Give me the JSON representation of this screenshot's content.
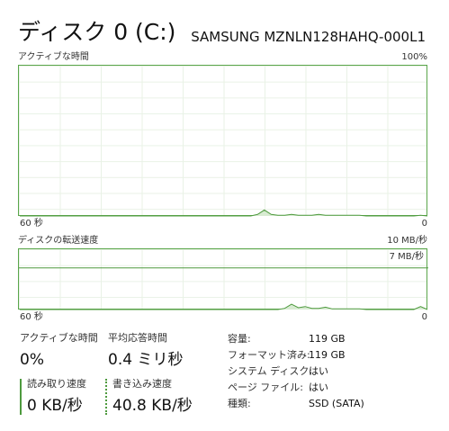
{
  "header": {
    "title": "ディスク 0 (C:)",
    "model": "SAMSUNG MZNLN128HAHQ-000L1"
  },
  "chart1": {
    "label": "アクティブな時間",
    "max_label": "100%",
    "time_left": "60 秒",
    "time_right": "0"
  },
  "chart2": {
    "label": "ディスクの転送速度",
    "max_label": "10 MB/秒",
    "line_label": "7 MB/秒",
    "time_left": "60 秒",
    "time_right": "0"
  },
  "stats": {
    "active_time_label": "アクティブな時間",
    "active_time_value": "0%",
    "avg_response_label": "平均応答時間",
    "avg_response_value": "0.4 ミリ秒",
    "read_speed_label": "読み取り速度",
    "read_speed_value": "0 KB/秒",
    "write_speed_label": "書き込み速度",
    "write_speed_value": "40.8 KB/秒"
  },
  "properties": [
    {
      "key": "容量:",
      "value": "119 GB"
    },
    {
      "key": "フォーマット済み:",
      "value": "119 GB"
    },
    {
      "key": "システム ディスク:",
      "value": "はい"
    },
    {
      "key": "ページ ファイル:",
      "value": "はい"
    },
    {
      "key": "種類:",
      "value": "SSD (SATA)"
    }
  ],
  "colors": {
    "accent": "#4e9a3e",
    "fill": "#d8ebd2",
    "grid": "#e9f2e6"
  },
  "chart_data": [
    {
      "type": "area",
      "name": "active-time",
      "ylim": [
        0,
        100
      ],
      "xlim": [
        60,
        0
      ],
      "x": [
        60,
        26,
        25,
        24,
        23,
        22,
        21,
        20,
        19,
        18,
        17,
        16,
        15,
        14,
        13,
        12,
        11,
        10,
        9,
        8,
        7,
        6,
        5,
        4,
        3,
        2,
        1,
        0
      ],
      "y": [
        0,
        0,
        1,
        4,
        1,
        0.5,
        0.5,
        1,
        0.5,
        0.5,
        0.5,
        1,
        0.5,
        0.5,
        0.5,
        0.5,
        0.5,
        0.5,
        0,
        0,
        0,
        0,
        0,
        0,
        0,
        0,
        0.5,
        0
      ]
    },
    {
      "type": "area",
      "name": "transfer-rate",
      "ylim": [
        0,
        10
      ],
      "xlim": [
        60,
        0
      ],
      "reference_line": 7,
      "series": [
        {
          "x": [
            60,
            22,
            21,
            20,
            19,
            18,
            17,
            16,
            15,
            14,
            13,
            12,
            11,
            10,
            9,
            8,
            7,
            6,
            5,
            4,
            3,
            2,
            1,
            0
          ],
          "y": [
            0,
            0,
            0.2,
            0.9,
            0.3,
            0.5,
            0.2,
            0.2,
            0.4,
            0.1,
            0.1,
            0.1,
            0.1,
            0.1,
            0,
            0,
            0,
            0,
            0,
            0,
            0,
            0,
            0.5,
            0
          ]
        }
      ]
    }
  ]
}
